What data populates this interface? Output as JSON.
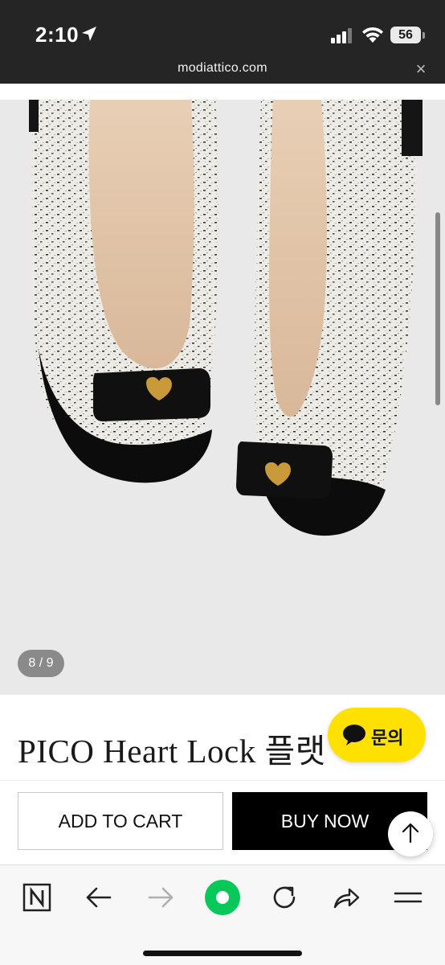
{
  "status_bar": {
    "time": "2:10",
    "battery": "56",
    "icons": [
      "location-arrow-icon",
      "cellular-signal-icon",
      "wifi-icon",
      "battery-icon"
    ]
  },
  "url_bar": {
    "domain": "modiattico.com",
    "close_symbol": "×"
  },
  "gallery": {
    "page_indicator": "8 / 9",
    "current_page": 8,
    "total_pages": 9
  },
  "product": {
    "title": "PICO Heart Lock 플랫"
  },
  "chat": {
    "label": "문의",
    "color": "#ffe100"
  },
  "cart_bar": {
    "add_to_cart_label": "ADD TO CART",
    "buy_now_label": "BUY NOW",
    "scroll_top_icon": "arrow-up-icon"
  },
  "browser_toolbar": {
    "icons": [
      "naver-n-icon",
      "back-arrow-icon",
      "forward-arrow-icon",
      "green-circle-icon",
      "reload-icon",
      "share-icon",
      "menu-icon"
    ],
    "accent": "#08c85a"
  }
}
